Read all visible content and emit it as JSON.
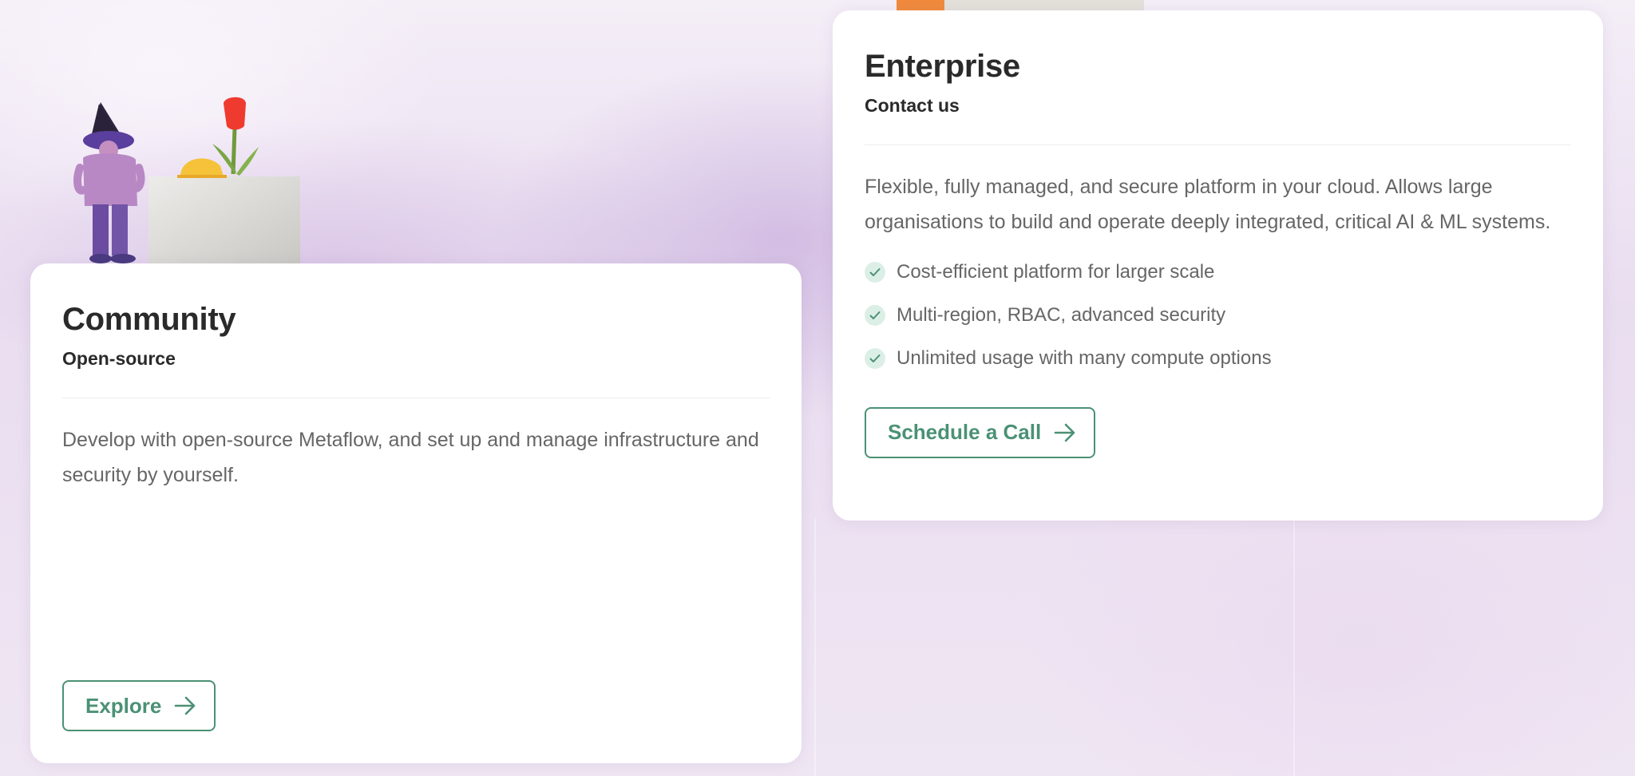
{
  "community": {
    "title": "Community",
    "subtitle": "Open-source",
    "description": "Develop with open-source Metaflow, and set up and manage infrastructure and security by yourself.",
    "button_label": "Explore"
  },
  "enterprise": {
    "title": "Enterprise",
    "subtitle": "Contact us",
    "description": "Flexible, fully managed, and secure platform in your cloud. Allows large organisations to build and operate deeply integrated, critical AI & ML systems.",
    "features": [
      "Cost-efficient platform for larger scale",
      "Multi-region, RBAC, advanced security",
      "Unlimited usage with many compute options"
    ],
    "button_label": "Schedule a Call"
  },
  "colors": {
    "accent": "#4b9175",
    "check_bg": "#dcefe6",
    "heading": "#2a2a2a",
    "body_text": "#666666"
  },
  "icons": {
    "button_arrow": "arrow-right-icon",
    "feature_bullet": "check-circle-icon"
  }
}
